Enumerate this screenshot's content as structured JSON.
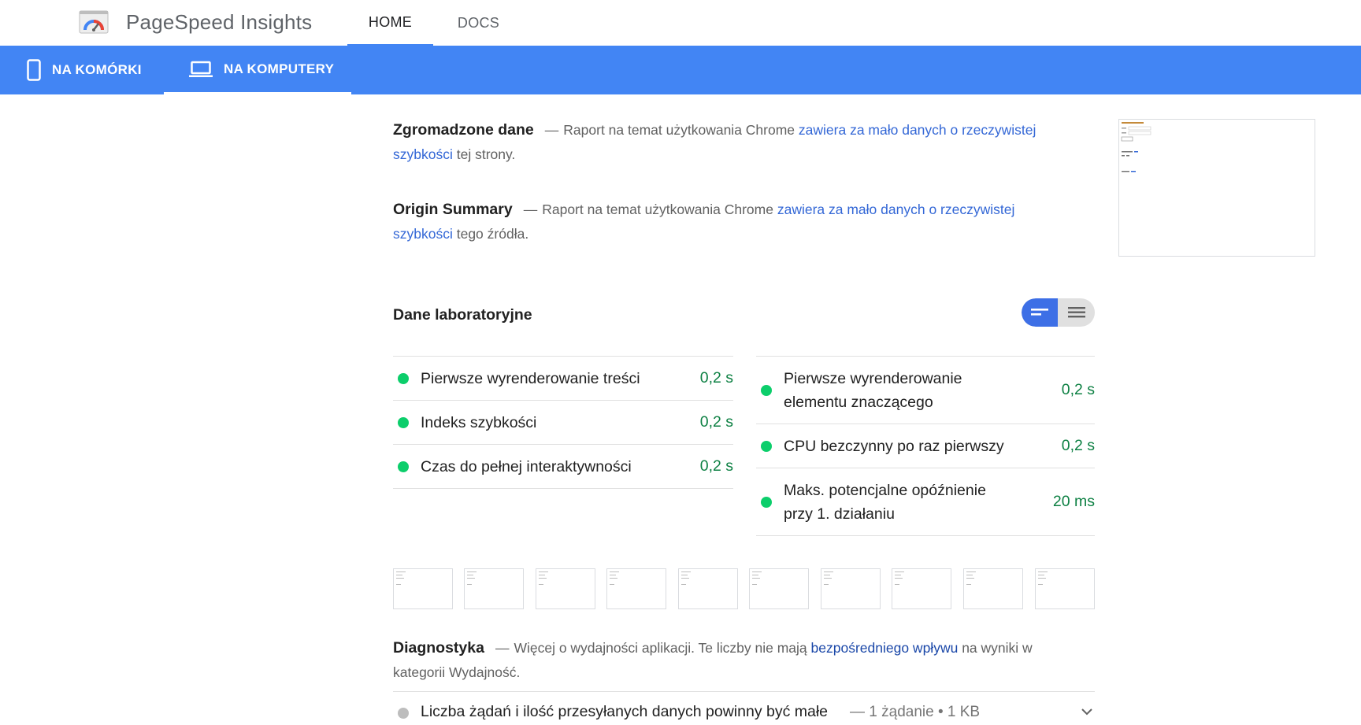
{
  "header": {
    "app_title": "PageSpeed Insights",
    "nav": [
      {
        "label": "HOME",
        "active": true
      },
      {
        "label": "DOCS",
        "active": false
      }
    ],
    "accent_color": "#4285f4"
  },
  "device_tabs": [
    {
      "label": "NA KOMÓRKI",
      "icon": "smartphone-icon",
      "active": false
    },
    {
      "label": "NA KOMPUTERY",
      "icon": "laptop-icon",
      "active": true
    }
  ],
  "field_data": {
    "title": "Zgromadzone dane",
    "dash": "—",
    "text_before": "Raport na temat użytkowania Chrome",
    "link_text": "zawiera za mało danych o rzeczywistej szybkości",
    "text_after": "tej strony."
  },
  "origin_summary": {
    "title": "Origin Summary",
    "dash": "—",
    "text_before": "Raport na temat użytkowania Chrome",
    "link_text": "zawiera za mało danych o rzeczywistej szybkości",
    "text_after": "tego źródła."
  },
  "lab_data": {
    "title": "Dane laboratoryjne",
    "view_toggle": {
      "selected": "opportunity-view",
      "icons": [
        "short-lines-icon",
        "list-lines-icon"
      ]
    },
    "metrics_left": [
      {
        "label": "Pierwsze wyrenderowanie treści",
        "value": "0,2 s",
        "status": "pass"
      },
      {
        "label": "Indeks szybkości",
        "value": "0,2 s",
        "status": "pass"
      },
      {
        "label": "Czas do pełnej interaktywności",
        "value": "0,2 s",
        "status": "pass"
      }
    ],
    "metrics_right": [
      {
        "label": "Pierwsze wyrenderowanie elementu znaczącego",
        "value": "0,2 s",
        "status": "pass"
      },
      {
        "label": "CPU bezczynny po raz pierwszy",
        "value": "0,2 s",
        "status": "pass"
      },
      {
        "label": "Maks. potencjalne opóźnienie przy 1. działaniu",
        "value": "20 ms",
        "status": "pass"
      }
    ],
    "pass_color": "#0cce6b",
    "value_color": "#0d8043"
  },
  "diagnostics": {
    "title": "Diagnostyka",
    "dash": "—",
    "text_before": "Więcej o wydajności aplikacji. Te liczby nie mają",
    "link_text": "bezpośredniego wpływu",
    "text_after": "na wyniki w kategorii Wydajność."
  },
  "audit": {
    "title": "Liczba żądań i ilość przesyłanych danych powinny być małe",
    "display_value": "— 1 żądanie • 1 KB",
    "icon": "chevron-down-icon"
  }
}
